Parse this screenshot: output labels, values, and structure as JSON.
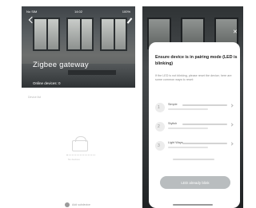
{
  "left_screen": {
    "status": {
      "carrier": "No SIM",
      "time": "14:02",
      "battery": "100%"
    },
    "title": "Zigbee gateway",
    "online_devices": "Online devices: 0",
    "device_list_label": "Device list",
    "empty_text": "No devices",
    "add_label": "Add subdevice"
  },
  "modal": {
    "title": "Ensure device is in pairing mode (LED is blinking)",
    "description": "If the LED is not blinking, please reset the device; here are some common ways to reset:",
    "items": [
      {
        "icon": "1",
        "label": "Simple"
      },
      {
        "icon": "2",
        "label": "Stylish"
      },
      {
        "icon": "3",
        "label": "Light Ways"
      }
    ],
    "button_label": "LED already blink"
  },
  "colors": {
    "accent": "#b9bdbf",
    "hero": "#4e5254"
  }
}
